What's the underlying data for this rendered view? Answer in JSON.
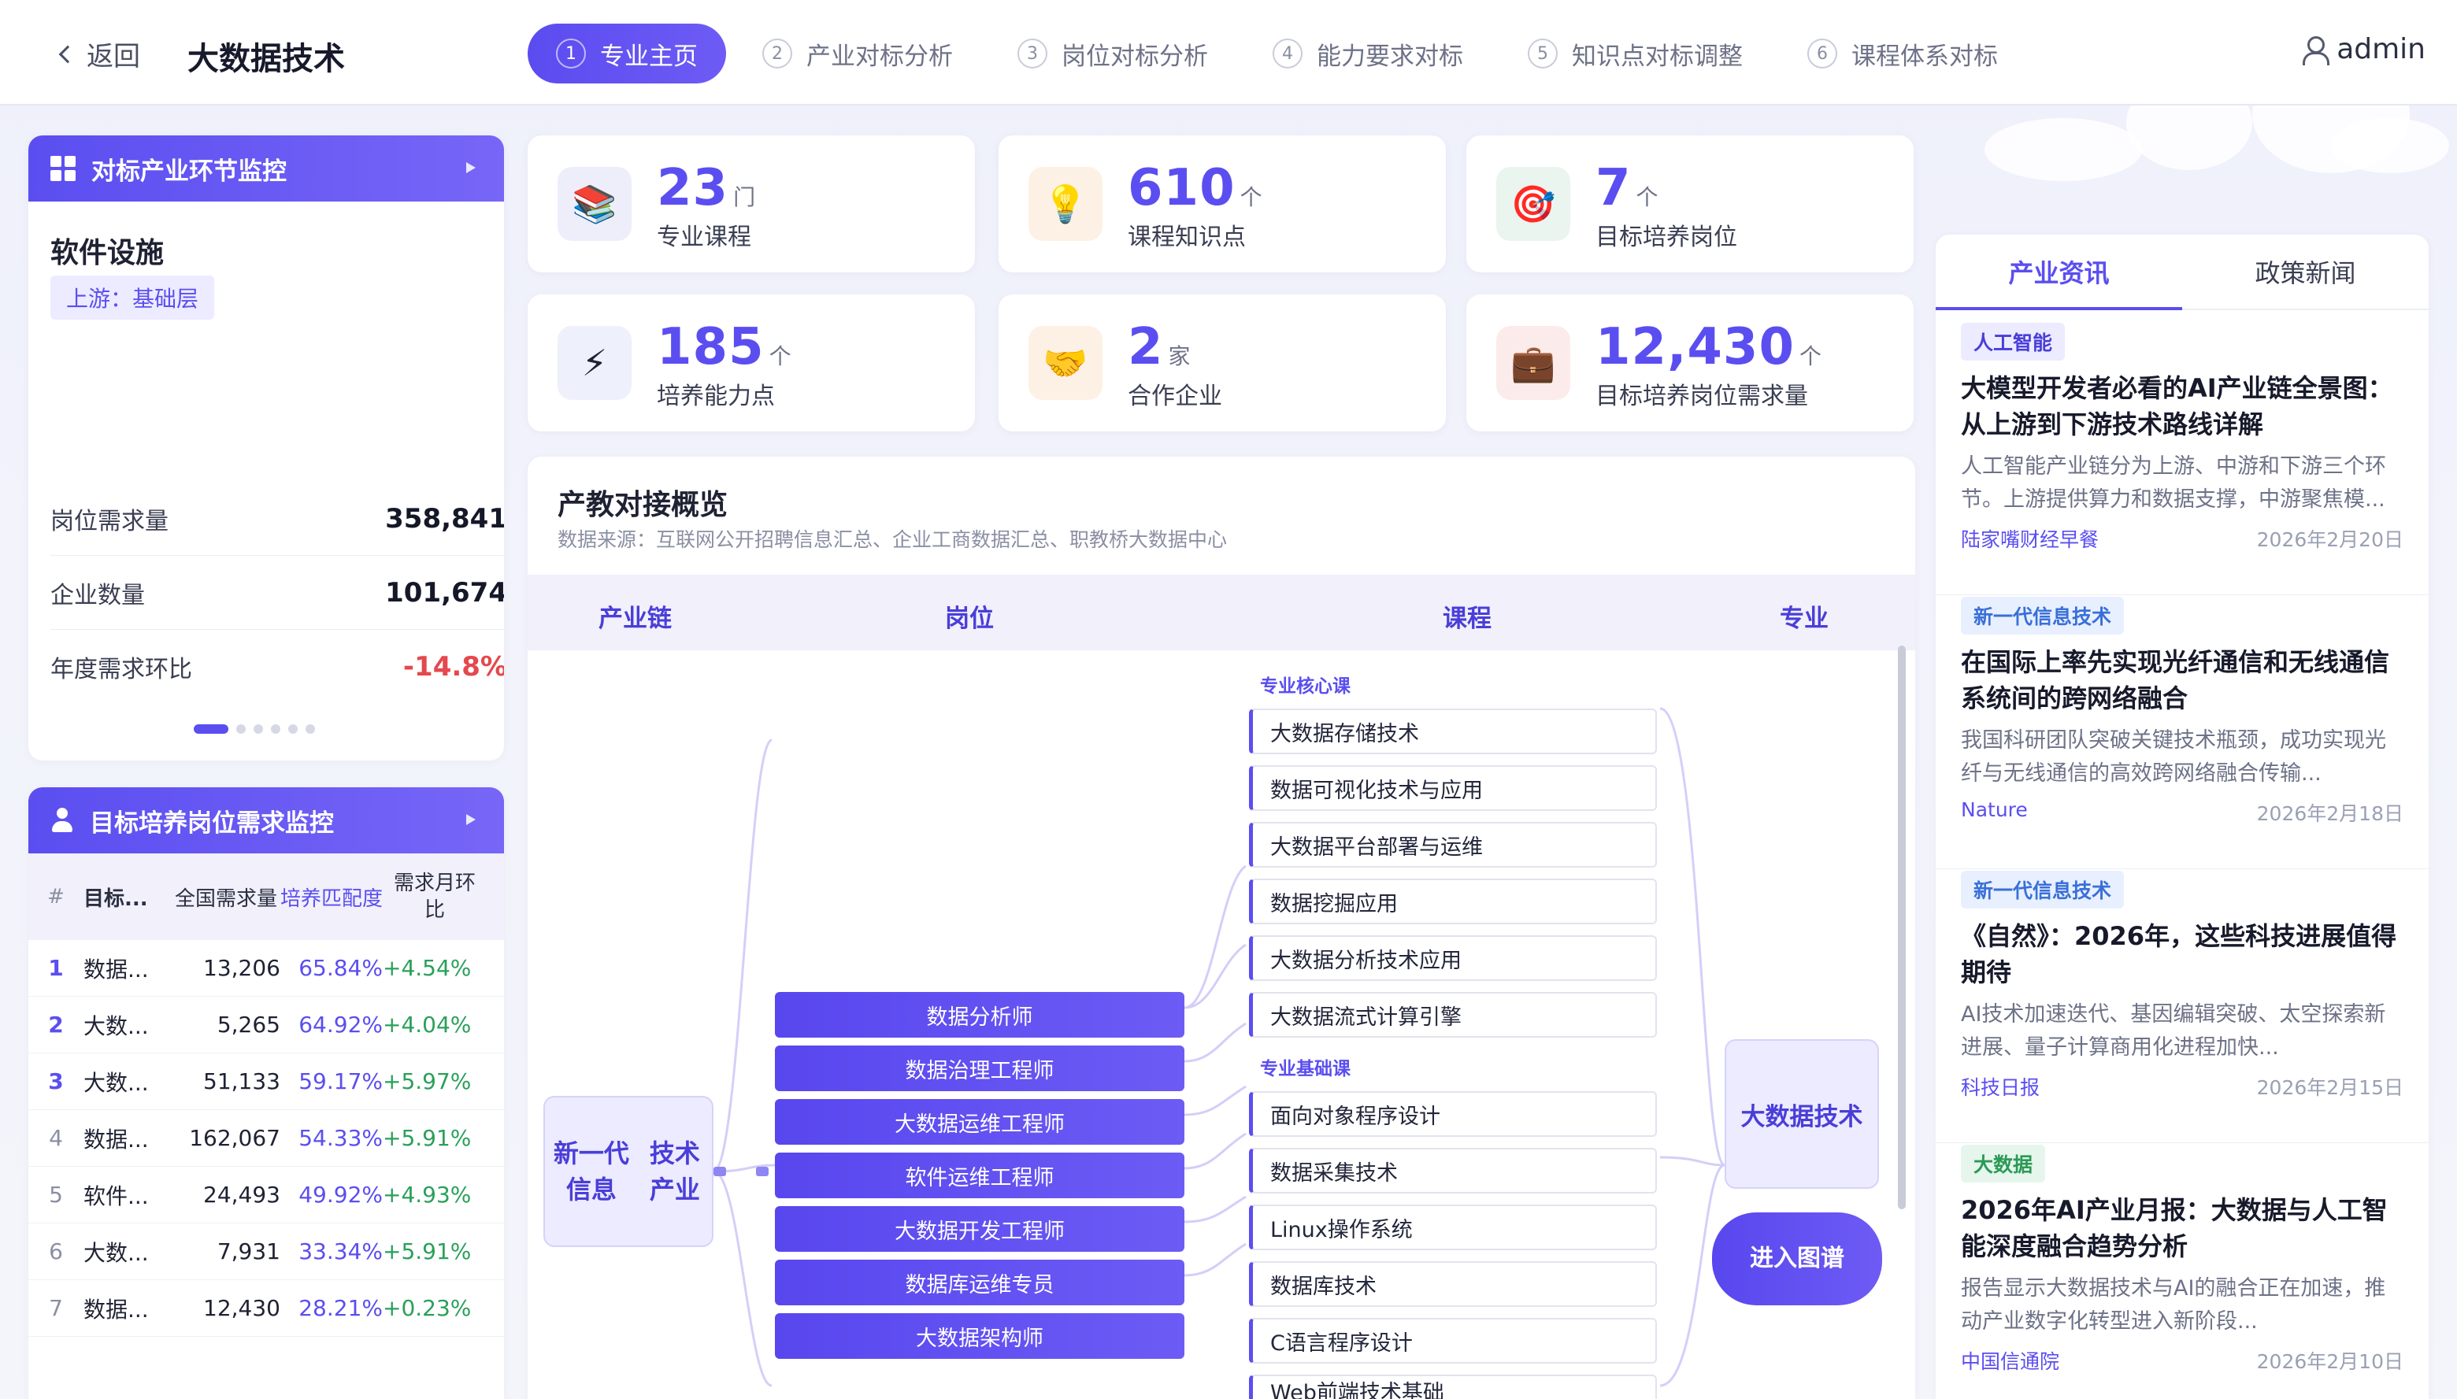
{
  "header": {
    "back_label": "返回",
    "title": "大数据技术",
    "steps": [
      {
        "num": "1",
        "label": "专业主页"
      },
      {
        "num": "2",
        "label": "产业对标分析"
      },
      {
        "num": "3",
        "label": "岗位对标分析"
      },
      {
        "num": "4",
        "label": "能力要求对标"
      },
      {
        "num": "5",
        "label": "知识点对标调整"
      },
      {
        "num": "6",
        "label": "课程体系对标"
      }
    ],
    "user": "admin"
  },
  "industry_panel": {
    "title": "对标产业环节监控",
    "segment_name": "软件设施",
    "segment_tag": "上游：基础层",
    "rows": [
      {
        "label": "岗位需求量",
        "value": "358,841"
      },
      {
        "label": "企业数量",
        "value": "101,674"
      },
      {
        "label": "年度需求环比",
        "value": "-14.8%"
      }
    ]
  },
  "demand_panel": {
    "title": "目标培养岗位需求监控",
    "headers": {
      "idx": "#",
      "name": "目标...",
      "total": "全国需求量",
      "match": "培养匹配度",
      "change": "需求月环比"
    },
    "rows": [
      {
        "idx": "1",
        "name": "数据...",
        "total": "13,206",
        "match": "65.84%",
        "change": "+4.54%"
      },
      {
        "idx": "2",
        "name": "大数...",
        "total": "5,265",
        "match": "64.92%",
        "change": "+4.04%"
      },
      {
        "idx": "3",
        "name": "大数...",
        "total": "51,133",
        "match": "59.17%",
        "change": "+5.97%"
      },
      {
        "idx": "4",
        "name": "数据...",
        "total": "162,067",
        "match": "54.33%",
        "change": "+5.91%"
      },
      {
        "idx": "5",
        "name": "软件...",
        "total": "24,493",
        "match": "49.92%",
        "change": "+4.93%"
      },
      {
        "idx": "6",
        "name": "大数...",
        "total": "7,931",
        "match": "33.34%",
        "change": "+5.91%"
      },
      {
        "idx": "7",
        "name": "数据...",
        "total": "12,430",
        "match": "28.21%",
        "change": "+0.23%"
      }
    ]
  },
  "stats": [
    {
      "value": "23",
      "unit": "门",
      "label": "专业课程",
      "icon": "books-icon"
    },
    {
      "value": "610",
      "unit": "个",
      "label": "课程知识点",
      "icon": "lightbulb-icon"
    },
    {
      "value": "7",
      "unit": "个",
      "label": "目标培养岗位",
      "icon": "target-icon"
    },
    {
      "value": "185",
      "unit": "个",
      "label": "培养能力点",
      "icon": "lightning-icon"
    },
    {
      "value": "2",
      "unit": "家",
      "label": "合作企业",
      "icon": "handshake-icon"
    },
    {
      "value": "12,430",
      "unit": "个",
      "label": "目标培养岗位需求量",
      "icon": "briefcase-icon"
    }
  ],
  "overview": {
    "title": "产教对接概览",
    "source": "数据来源：互联网公开招聘信息汇总、企业工商数据汇总、职教桥大数据中心",
    "columns": [
      "产业链",
      "岗位",
      "课程",
      "专业"
    ],
    "chain": "新一代信息技术产业",
    "jobs": [
      "数据分析师",
      "数据治理工程师",
      "大数据运维工程师",
      "软件运维工程师",
      "大数据开发工程师",
      "数据库运维专员",
      "大数据架构师"
    ],
    "core_group": "专业核心课",
    "core_courses": [
      "大数据存储技术",
      "数据可视化技术与应用",
      "大数据平台部署与运维",
      "数据挖掘应用",
      "大数据分析技术应用",
      "大数据流式计算引擎"
    ],
    "base_group": "专业基础课",
    "base_courses": [
      "面向对象程序设计",
      "数据采集技术",
      "Linux操作系统",
      "数据库技术",
      "C语言程序设计",
      "Web前端技术基础"
    ],
    "major": "大数据技术",
    "enter_button": "进入图谱"
  },
  "news": {
    "tabs": [
      "产业资讯",
      "政策新闻"
    ],
    "items": [
      {
        "tag": "人工智能",
        "title": "大模型开发者必看的AI产业链全景图：从上游到下游技术路线详解",
        "summary": "人工智能产业链分为上游、中游和下游三个环节。上游提供算力和数据支撑，中游聚焦模...",
        "source": "陆家嘴财经早餐",
        "date": "2026年2月20日"
      },
      {
        "tag": "新一代信息技术",
        "title": "在国际上率先实现光纤通信和无线通信系统间的跨网络融合",
        "summary": "我国科研团队突破关键技术瓶颈，成功实现光纤与无线通信的高效跨网络融合传输...",
        "source": "Nature",
        "date": "2026年2月18日"
      },
      {
        "tag": "新一代信息技术",
        "title": "《自然》：2026年，这些科技进展值得期待",
        "summary": "AI技术加速迭代、基因编辑突破、太空探索新进展、量子计算商用化进程加快...",
        "source": "科技日报",
        "date": "2026年2月15日"
      },
      {
        "tag": "大数据",
        "title": "2026年AI产业月报：大数据与人工智能深度融合趋势分析",
        "summary": "报告显示大数据技术与AI的融合正在加速，推动产业数字化转型进入新阶段...",
        "source": "中国信通院",
        "date": "2026年2月10日"
      }
    ]
  },
  "colors": {
    "accent": "#5b4ef0",
    "negative": "#e5484d",
    "positive": "#2aa05a"
  }
}
